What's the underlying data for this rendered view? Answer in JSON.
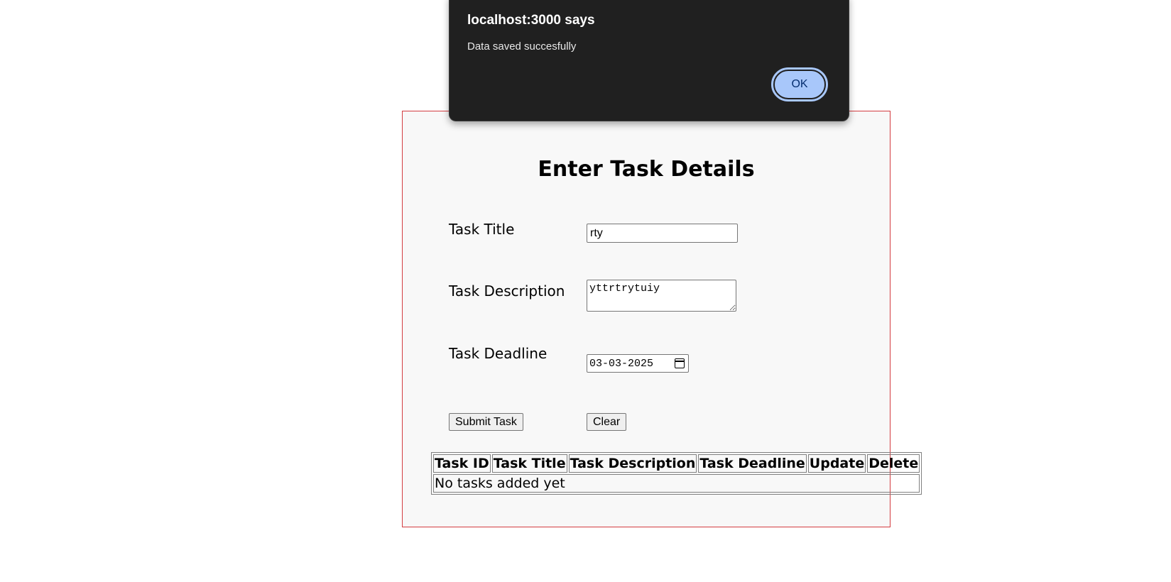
{
  "dialog": {
    "title": "localhost:3000 says",
    "message": "Data saved succesfully",
    "ok_label": "OK"
  },
  "form": {
    "heading": "Enter Task Details",
    "title_label": "Task Title",
    "title_value": "rty",
    "description_label": "Task Description",
    "description_value": "yttrtrytuiy",
    "deadline_label": "Task Deadline",
    "deadline_value": "03-03-2025",
    "submit_label": "Submit Task",
    "clear_label": "Clear"
  },
  "table": {
    "headers": [
      "Task ID",
      "Task Title",
      "Task Description",
      "Task Deadline",
      "Update",
      "Delete"
    ],
    "empty_message": "No tasks added yet"
  },
  "colors": {
    "card_border": "#d33c40",
    "dialog_bg": "#202020",
    "ok_button_bg": "#a8c7fa"
  }
}
